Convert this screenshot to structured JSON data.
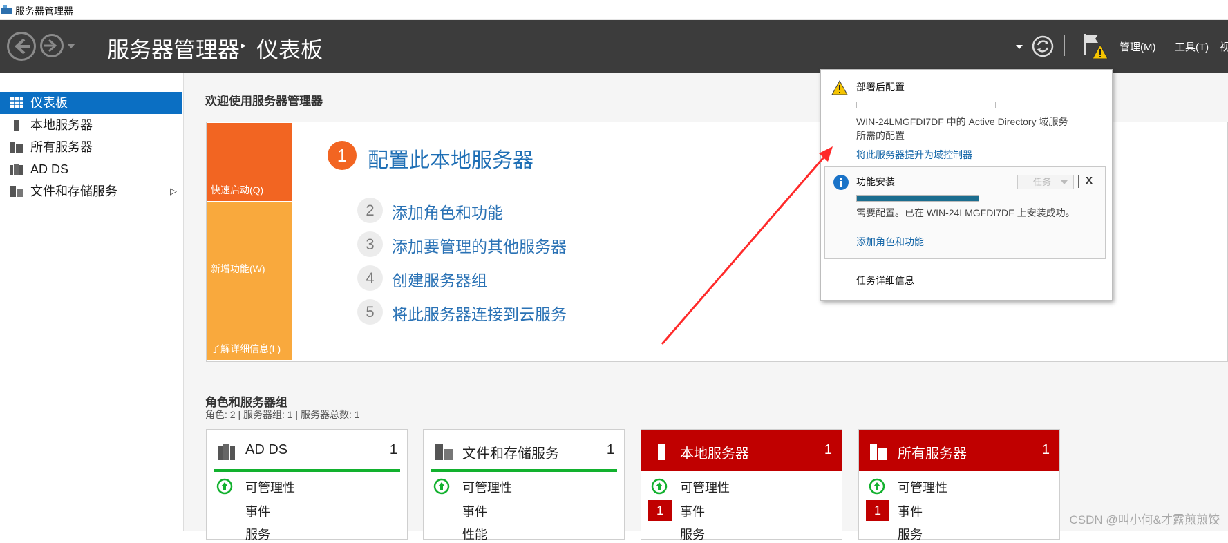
{
  "window": {
    "title": "服务器管理器",
    "minimize": "–"
  },
  "header": {
    "crumb_root": "服务器管理器",
    "crumb_sep": "▸",
    "crumb_page": "仪表板",
    "menus": [
      "管理(M)",
      "工具(T)",
      "视"
    ]
  },
  "sidebar": {
    "items": [
      {
        "label": "仪表板",
        "icon": "dashboard-icon"
      },
      {
        "label": "本地服务器",
        "icon": "server-icon"
      },
      {
        "label": "所有服务器",
        "icon": "servers-icon"
      },
      {
        "label": "AD DS",
        "icon": "ad-ds-icon"
      },
      {
        "label": "文件和存储服务",
        "icon": "storage-icon"
      }
    ],
    "expand_glyph": "▷"
  },
  "welcome": {
    "title": "欢迎使用服务器管理器",
    "tiles": [
      "快速启动(Q)",
      "新增功能(W)",
      "了解详细信息(L)"
    ],
    "main_step": {
      "num": "1",
      "label": "配置此本地服务器"
    },
    "steps": [
      {
        "num": "2",
        "label": "添加角色和功能"
      },
      {
        "num": "3",
        "label": "添加要管理的其他服务器"
      },
      {
        "num": "4",
        "label": "创建服务器组"
      },
      {
        "num": "5",
        "label": "将此服务器连接到云服务"
      }
    ]
  },
  "roles": {
    "title": "角色和服务器组",
    "subtitle": "角色: 2 | 服务器组: 1 | 服务器总数: 1",
    "cards": [
      {
        "name": "AD DS",
        "count": "1",
        "rows": [
          "可管理性",
          "事件",
          "服务"
        ]
      },
      {
        "name": "文件和存储服务",
        "count": "1",
        "rows": [
          "可管理性",
          "事件",
          "性能"
        ]
      },
      {
        "name": "本地服务器",
        "count": "1",
        "rows": [
          "可管理性",
          "事件",
          "服务"
        ],
        "event_badge": "1"
      },
      {
        "name": "所有服务器",
        "count": "1",
        "rows": [
          "可管理性",
          "事件",
          "服务"
        ],
        "event_badge": "1"
      }
    ]
  },
  "notifications": {
    "post_deploy": {
      "title": "部署后配置",
      "text_line1": "WIN-24LMGFDI7DF 中的 Active Directory 域服务",
      "text_line2": "所需的配置",
      "link": "将此服务器提升为域控制器"
    },
    "feature_install": {
      "title": "功能安装",
      "task_dropdown": "任务",
      "close": "X",
      "progress": 1.0,
      "status": "需要配置。已在 WIN-24LMGFDI7DF 上安装成功。",
      "link": "添加角色和功能"
    },
    "task_details": "任务详细信息"
  },
  "watermark": "CSDN @叫小何&才露煎煎饺",
  "colors": {
    "accent_blue": "#0b6fc3",
    "orange_dark": "#f26522",
    "orange_light": "#f9a93d",
    "alert_red": "#c00000",
    "green": "#12b12e",
    "annotation_red": "#ff2a2a"
  }
}
